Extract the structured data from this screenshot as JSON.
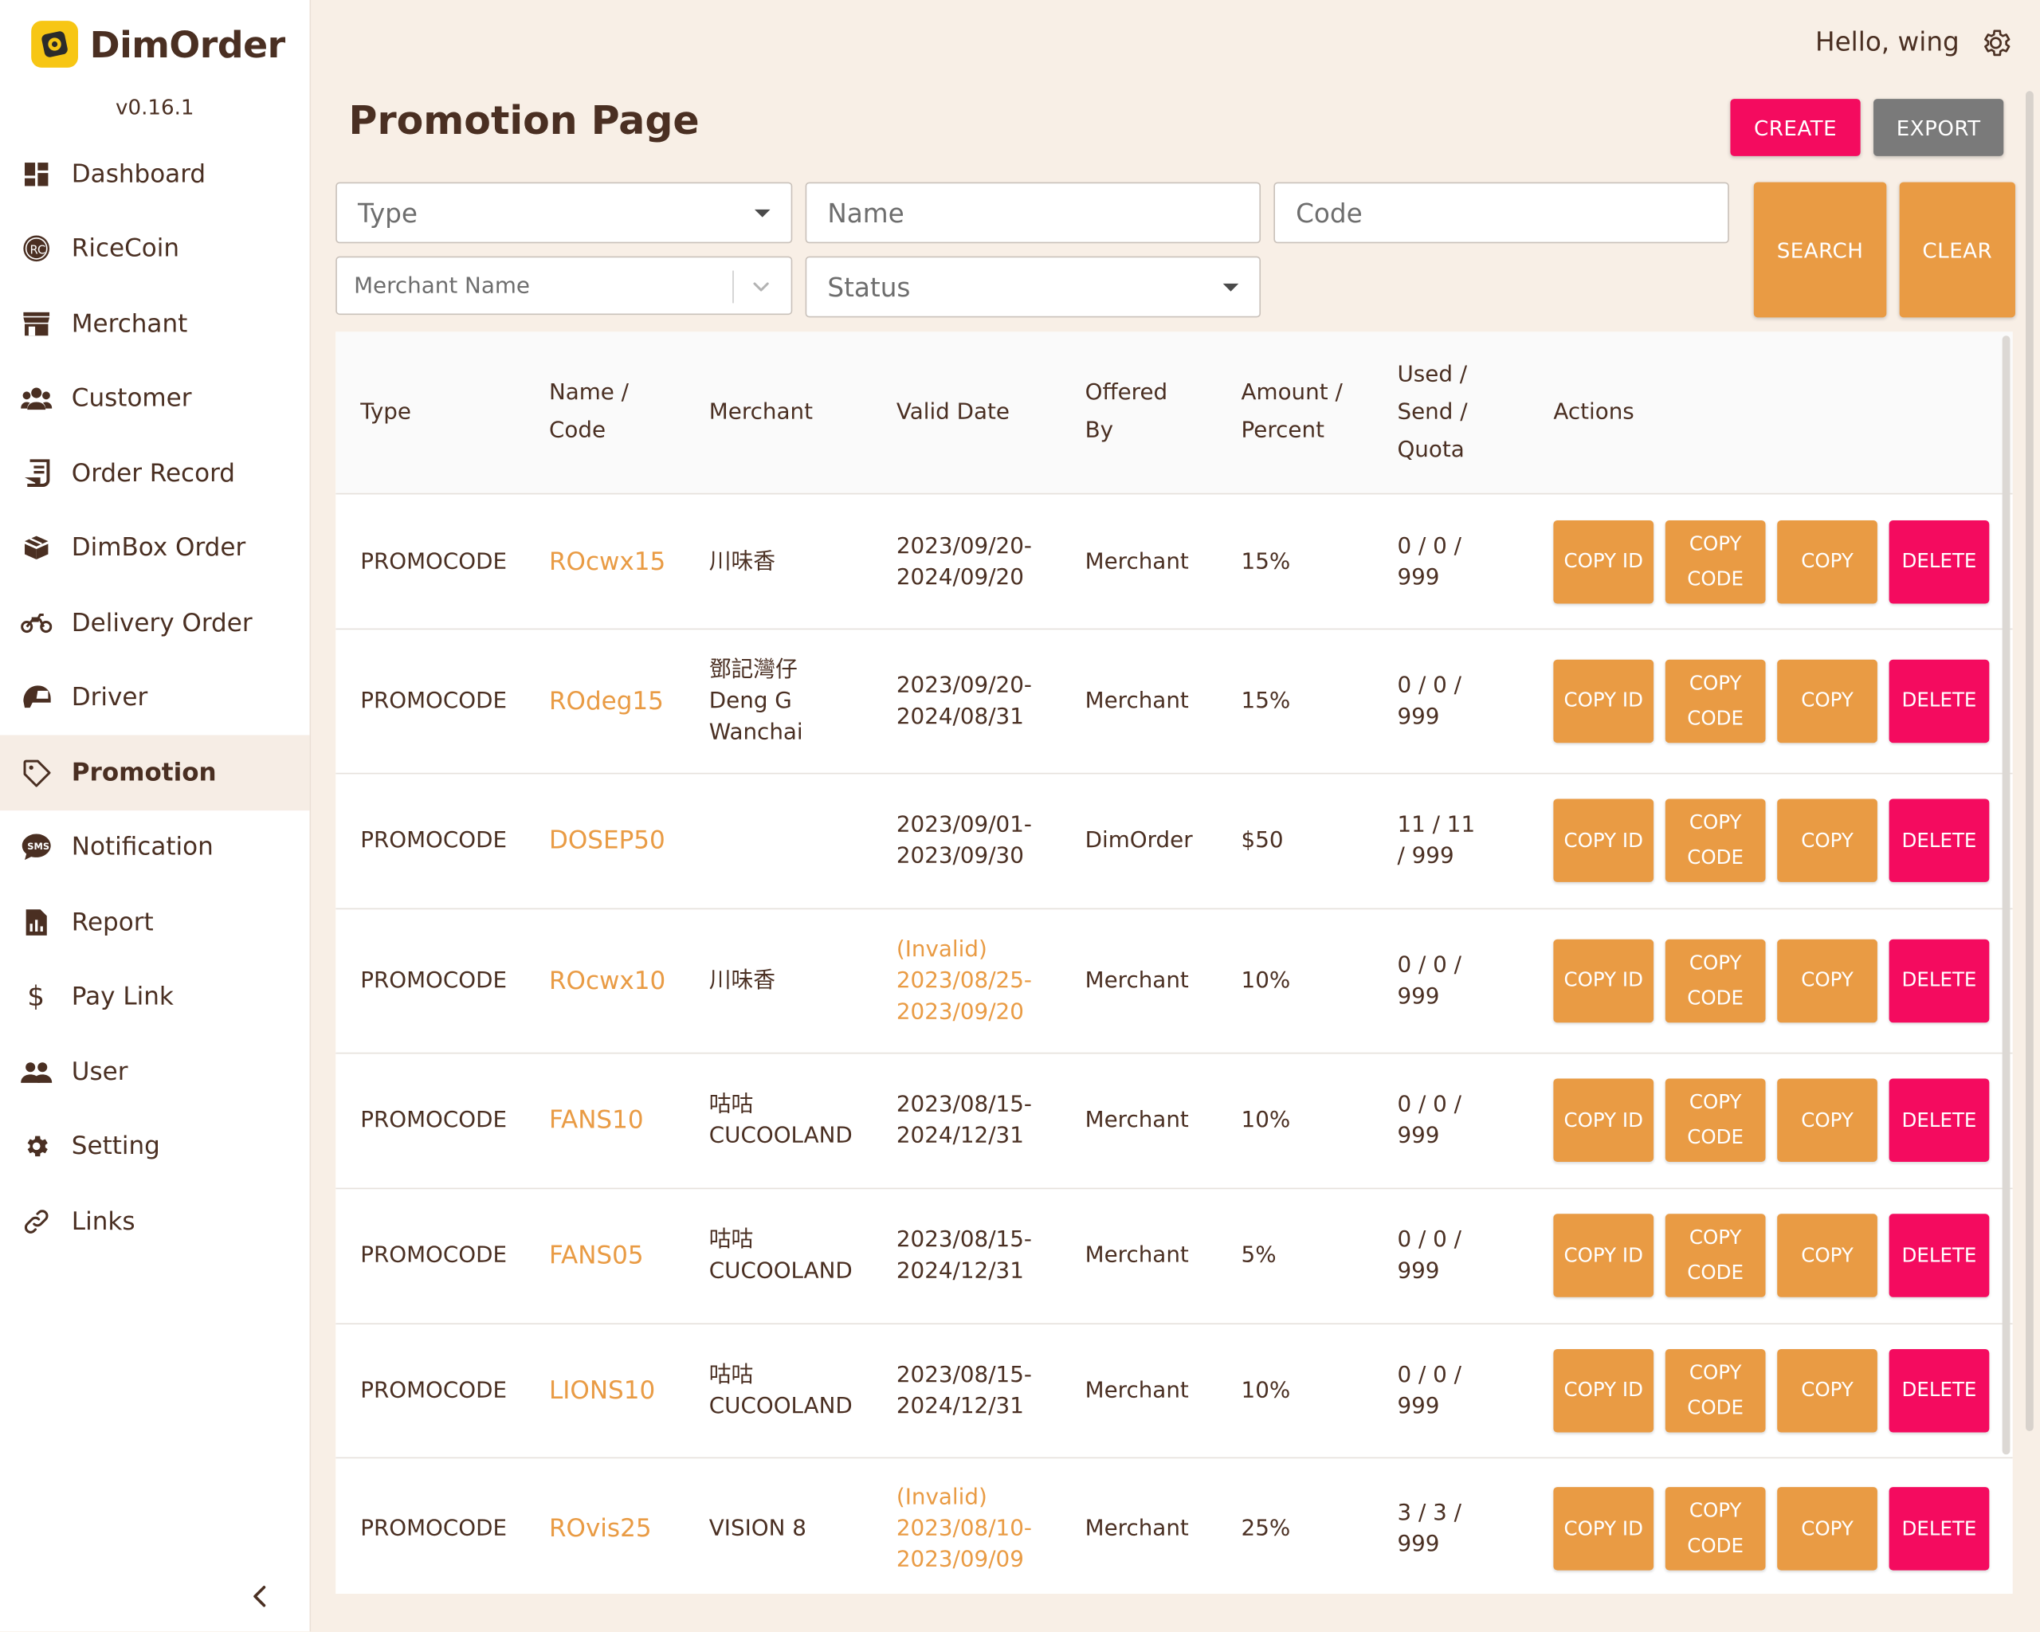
{
  "app": {
    "name": "DimOrder",
    "version": "v0.16.1"
  },
  "header": {
    "greeting": "Hello, wing"
  },
  "page": {
    "title": "Promotion Page"
  },
  "toolbar": {
    "create_label": "CREATE",
    "export_label": "EXPORT",
    "search_label": "SEARCH",
    "clear_label": "CLEAR"
  },
  "filters": {
    "type_placeholder": "Type",
    "name_placeholder": "Name",
    "code_placeholder": "Code",
    "merchant_placeholder": "Merchant Name",
    "status_placeholder": "Status"
  },
  "sidebar": {
    "items": [
      {
        "label": "Dashboard",
        "icon": "dashboard-icon"
      },
      {
        "label": "RiceCoin",
        "icon": "ricecoin-icon"
      },
      {
        "label": "Merchant",
        "icon": "store-icon"
      },
      {
        "label": "Customer",
        "icon": "people-icon"
      },
      {
        "label": "Order Record",
        "icon": "receipt-icon"
      },
      {
        "label": "DimBox Order",
        "icon": "box-icon"
      },
      {
        "label": "Delivery Order",
        "icon": "motorcycle-icon"
      },
      {
        "label": "Driver",
        "icon": "helmet-icon"
      },
      {
        "label": "Promotion",
        "icon": "tag-icon",
        "active": true
      },
      {
        "label": "Notification",
        "icon": "sms-icon"
      },
      {
        "label": "Report",
        "icon": "report-icon"
      },
      {
        "label": "Pay Link",
        "icon": "dollar-icon"
      },
      {
        "label": "User",
        "icon": "users-icon"
      },
      {
        "label": "Setting",
        "icon": "gear-icon"
      },
      {
        "label": "Links",
        "icon": "link-icon"
      }
    ]
  },
  "table": {
    "columns": [
      "Type",
      "Name / Code",
      "Merchant",
      "Valid Date",
      "Offered By",
      "Amount / Percent",
      "Used / Send / Quota",
      "Actions"
    ],
    "action_labels": {
      "copy_id": "COPY ID",
      "copy_code": "COPY CODE",
      "copy": "COPY",
      "delete": "DELETE"
    },
    "rows": [
      {
        "type": "PROMOCODE",
        "code": "ROcwx15",
        "merchant": "川味香",
        "invalid": "",
        "valid_date": "2023/09/20-2024/09/20",
        "offered_by": "Merchant",
        "amount": "15%",
        "usage": "0 / 0 / 999"
      },
      {
        "type": "PROMOCODE",
        "code": "ROdeg15",
        "merchant": "鄧記灣仔 Deng G Wanchai",
        "invalid": "",
        "valid_date": "2023/09/20-2024/08/31",
        "offered_by": "Merchant",
        "amount": "15%",
        "usage": "0 / 0 / 999"
      },
      {
        "type": "PROMOCODE",
        "code": "DOSEP50",
        "merchant": "",
        "invalid": "",
        "valid_date": "2023/09/01-2023/09/30",
        "offered_by": "DimOrder",
        "amount": "$50",
        "usage": "11 / 11 / 999"
      },
      {
        "type": "PROMOCODE",
        "code": "ROcwx10",
        "merchant": "川味香",
        "invalid": "(Invalid)",
        "valid_date": "2023/08/25-2023/09/20",
        "offered_by": "Merchant",
        "amount": "10%",
        "usage": "0 / 0 / 999"
      },
      {
        "type": "PROMOCODE",
        "code": "FANS10",
        "merchant": "咕咕 CUCOOLAND",
        "invalid": "",
        "valid_date": "2023/08/15-2024/12/31",
        "offered_by": "Merchant",
        "amount": "10%",
        "usage": "0 / 0 / 999"
      },
      {
        "type": "PROMOCODE",
        "code": "FANS05",
        "merchant": "咕咕 CUCOOLAND",
        "invalid": "",
        "valid_date": "2023/08/15-2024/12/31",
        "offered_by": "Merchant",
        "amount": "5%",
        "usage": "0 / 0 / 999"
      },
      {
        "type": "PROMOCODE",
        "code": "LIONS10",
        "merchant": "咕咕 CUCOOLAND",
        "invalid": "",
        "valid_date": "2023/08/15-2024/12/31",
        "offered_by": "Merchant",
        "amount": "10%",
        "usage": "0 / 0 / 999"
      },
      {
        "type": "PROMOCODE",
        "code": "ROvis25",
        "merchant": "VISION 8",
        "invalid": "(Invalid)",
        "valid_date": "2023/08/10-2023/09/09",
        "offered_by": "Merchant",
        "amount": "25%",
        "usage": "3 / 3 / 999"
      }
    ]
  },
  "colors": {
    "accent_orange": "#e99b44",
    "accent_pink": "#f40b5f",
    "neutral_gray": "#7a7a7a",
    "text_brown": "#4a2f22",
    "background": "#f8efe6"
  }
}
